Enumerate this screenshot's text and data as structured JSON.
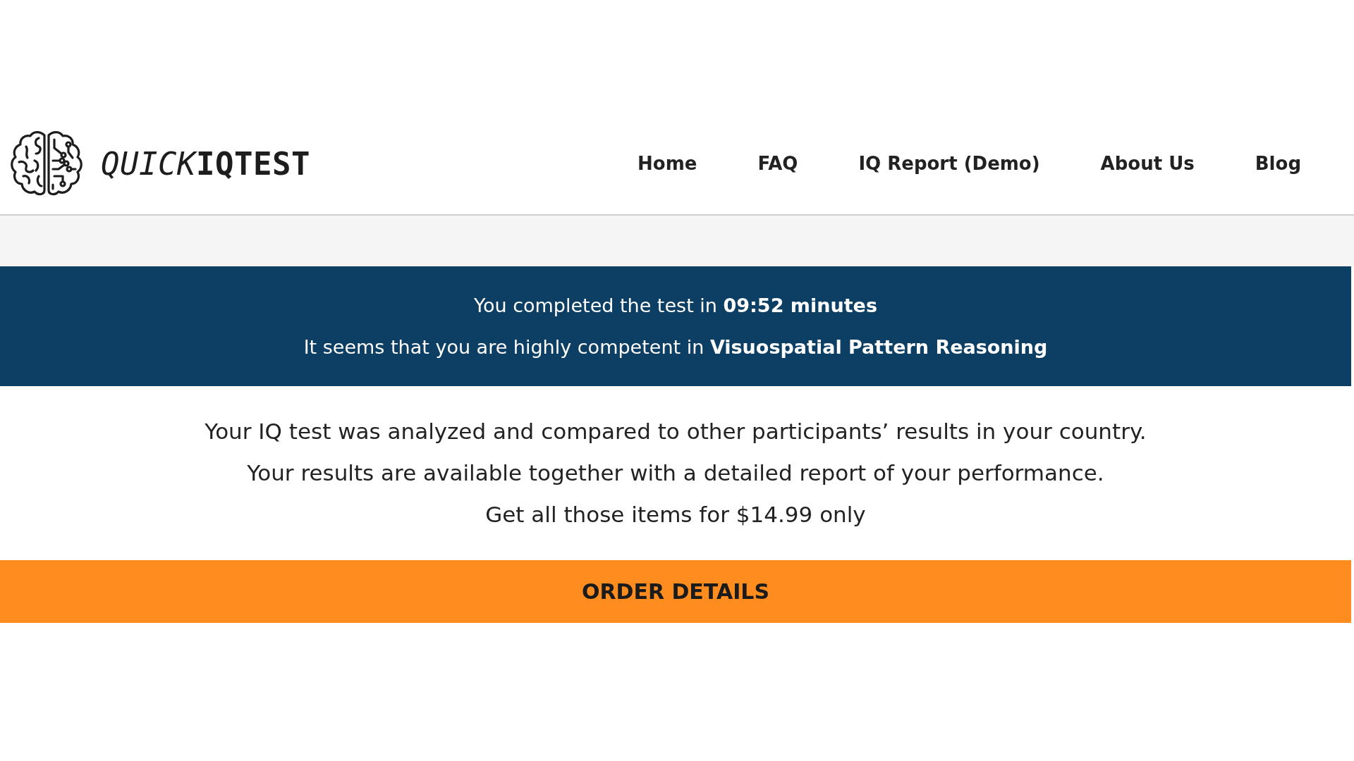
{
  "header": {
    "logo": {
      "brand_light": "QUICK",
      "brand_bold": "IQTEST"
    },
    "nav": [
      {
        "label": "Home"
      },
      {
        "label": "FAQ"
      },
      {
        "label": "IQ Report (Demo)"
      },
      {
        "label": "About Us"
      },
      {
        "label": "Blog"
      }
    ]
  },
  "banner": {
    "lines": [
      "You completed the test in **09:52 minutes**",
      "It seems that you are highly competent in **Visuospatial Pattern Reasoning**"
    ]
  },
  "summary": {
    "lines": [
      "Your IQ test was analyzed and compared to other participants’ results in your country.",
      "Your results are available together with a detailed report of your performance.",
      "Get all those items for $14.99 only"
    ]
  },
  "order_button": {
    "label": "ORDER DETAILS"
  }
}
